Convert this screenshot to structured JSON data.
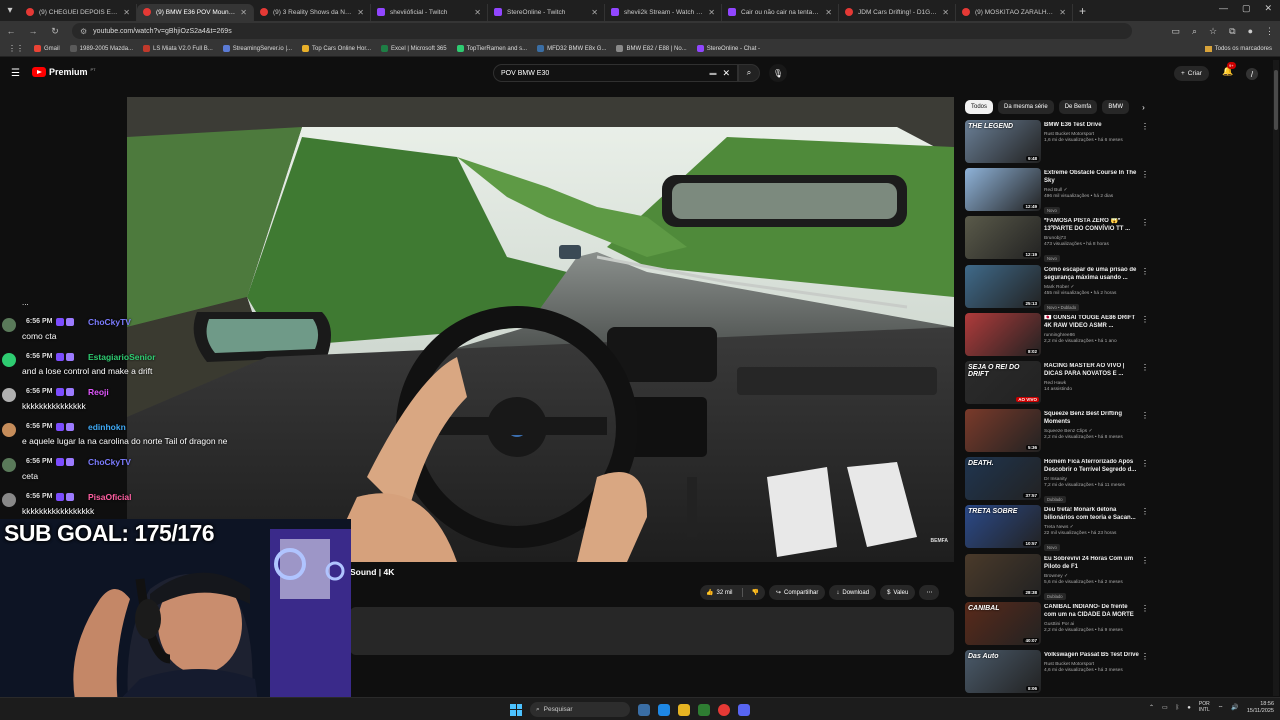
{
  "browser": {
    "tabs": [
      {
        "title": "(9) CHEGUEI DEPOIS E PEGUEI",
        "type": "yt"
      },
      {
        "title": "(9) BMW E36 POV Mountain Dri",
        "type": "yt",
        "active": true
      },
      {
        "title": "(9) 3 Reality Shows da NETFLIX",
        "type": "yt"
      },
      {
        "title": "sheviióficial - Twitch",
        "type": "twitch"
      },
      {
        "title": "StereOnline - Twitch",
        "type": "twitch"
      },
      {
        "title": "shevii2k Stream - Watch Live o",
        "type": "twitch"
      },
      {
        "title": "Cair ou não cair na tentação? |",
        "type": "twitch"
      },
      {
        "title": "JDM Cars Drifting! - D1GP at E",
        "type": "yt"
      },
      {
        "title": "(9) MOSKITÃO ZARALHANDO",
        "type": "yt"
      }
    ],
    "url": "youtube.com/watch?v=gBhjiOzS2a4&t=269s",
    "bookmarks": [
      "Gmail",
      "1989-2005 Mazda...",
      "LS Miata V2.0 Full B...",
      "StreamingServer.io |...",
      "Top Cars Online Hor...",
      "Excel | Microsoft 365",
      "TopTierRamen and s...",
      "MFD32 BMW E8x G...",
      "BMW E82 / E88 | No...",
      "StereOnline - Chat -"
    ],
    "bookmarks_all": "Todos os marcadores"
  },
  "youtube": {
    "logo": "Premium",
    "logo_region": "PT",
    "search_query": "POV BMW E30",
    "create_label": "Criar",
    "notifications": "9+",
    "video": {
      "title_fragment": "Sound | 4K",
      "watermark": "BEMFA",
      "likes": "32 mil",
      "share": "Compartilhar",
      "download": "Download",
      "thanks": "Valeu"
    },
    "chips": [
      "Todos",
      "Da mesma série",
      "De Bemfa",
      "BMW"
    ],
    "recommendations": [
      {
        "title": "BMW E36 Test Drive",
        "channel": "Rust Bucket Motorsport",
        "meta": "1,6 mi de visualizações • há 6 meses",
        "duration": "9:48",
        "overlay": "THE LEGEND",
        "color": "#6a7f96",
        "badge": ""
      },
      {
        "title": "Extreme Obstacle Course In The Sky",
        "channel": "Red Bull ✓",
        "meta": "496 mil visualizações • há 2 dias",
        "duration": "12:49",
        "overlay": "",
        "color": "#8fb3d9",
        "badge": "Novo"
      },
      {
        "title": "*FAMOSA PISTA ZERO 😱* 13ºPARTE DO CONVÍVIO TT ...",
        "channel": "Brunobj73",
        "meta": "473 visualizações • há 8 horas",
        "duration": "12:19",
        "overlay": "",
        "color": "#5a5a4a",
        "badge": "Novo"
      },
      {
        "title": "Como escapar de uma prisão de segurança máxima usando ...",
        "channel": "Mark Rober ✓",
        "meta": "455 mil visualizações • há 2 horas",
        "duration": "25:13",
        "overlay": "",
        "color": "#3f6a8a",
        "badge": "Novo • Dublado"
      },
      {
        "title": "🇯🇵 GUNSAI TOUGE AE86 DRIFT 4K RAW VIDEO ASMR ...",
        "channel": "runninghree86",
        "meta": "2,2 mi de visualizações • há 1 ano",
        "duration": "8:02",
        "overlay": "",
        "color": "#b03b3b",
        "badge": ""
      },
      {
        "title": "RACING MASTER AO VIVO | DICAS PARA NOVATOS E ...",
        "channel": "Red Hawk",
        "meta": "14 assistindo",
        "duration": "AO VIVO",
        "overlay": "SEJA O REI DO DRIFT",
        "color": "#2b2b2b",
        "badge": ""
      },
      {
        "title": "Squeeze Benz Best Drifting Moments",
        "channel": "Squeeze Benz Clips ✓",
        "meta": "2,2 mi de visualizações • há 8 meses",
        "duration": "5:36",
        "overlay": "",
        "color": "#7a3a2a",
        "badge": ""
      },
      {
        "title": "Homem Fica Aterrorizado Após Descobrir o Terrível Segredo d...",
        "channel": "Dr Insanity",
        "meta": "7,2 mi de visualizações • há 11 meses",
        "duration": "37:57",
        "overlay": "DEATH.",
        "color": "#1f3550",
        "badge": "Dublado"
      },
      {
        "title": "Deu treta! Monark detona bilionários com teoria e Sacan...",
        "channel": "Treta News ✓",
        "meta": "22 mil visualizações • há 23 horas",
        "duration": "10:57",
        "overlay": "TRETA SOBRE",
        "color": "#2b4a8a",
        "badge": "Novo"
      },
      {
        "title": "Eu Sobrevivi 24 Horas Com um Piloto de F1",
        "channel": "Browney ✓",
        "meta": "5,6 mi de visualizações • há 2 meses",
        "duration": "28:38",
        "overlay": "",
        "color": "#4a3a2a",
        "badge": "Dublado"
      },
      {
        "title": "CANIBAL INDIANO- De frente com um na CIDADE DA MORTE",
        "channel": "Gusttini Por ai",
        "meta": "2,2 mi de visualizações • há 9 meses",
        "duration": "40:07",
        "overlay": "CANIBAL",
        "color": "#5a2a1a",
        "badge": ""
      },
      {
        "title": "Volkswagen Passat B5 Test Drive",
        "channel": "Rust Bucket Motorsport",
        "meta": "4,6 mi de visualizações • há 3 meses",
        "duration": "8:06",
        "overlay": "Das Auto",
        "color": "#4a5a6a",
        "badge": ""
      }
    ]
  },
  "chat": {
    "dots": "...",
    "messages": [
      {
        "time": "6:56 PM",
        "user": "ChoCkyTV",
        "color": "#7c7cff",
        "text": "como cta",
        "avatar": "#5a7a5a"
      },
      {
        "time": "6:56 PM",
        "user": "EstagiarioSenior",
        "color": "#2ecc71",
        "text": "and a lose control and make a drift",
        "avatar": "#2ecc71"
      },
      {
        "time": "6:56 PM",
        "user": "Reoji",
        "color": "#e056fd",
        "text": "kkkkkkkkkkkkkkk",
        "avatar": "#b0b0b0"
      },
      {
        "time": "6:56 PM",
        "user": "edinhokn",
        "color": "#3fa9f5",
        "text": "e aquele lugar la na carolina do norte Tail of dragon ne",
        "avatar": "#c58c5a"
      },
      {
        "time": "6:56 PM",
        "user": "ChoCkyTV",
        "color": "#7c7cff",
        "text": "ceta",
        "avatar": "#5a7a5a"
      },
      {
        "time": "6:56 PM",
        "user": "PisaOficial",
        "color": "#ff5fa2",
        "text": "kkkkkkkkkkkkkkkkk",
        "avatar": "#888888"
      }
    ]
  },
  "stream": {
    "sub_goal": "SUB GOAL: 175/176"
  },
  "taskbar": {
    "search": "Pesquisar",
    "lang_line1": "POR",
    "lang_line2": "INTL",
    "time": "18:56",
    "date": "15/11/2025"
  }
}
